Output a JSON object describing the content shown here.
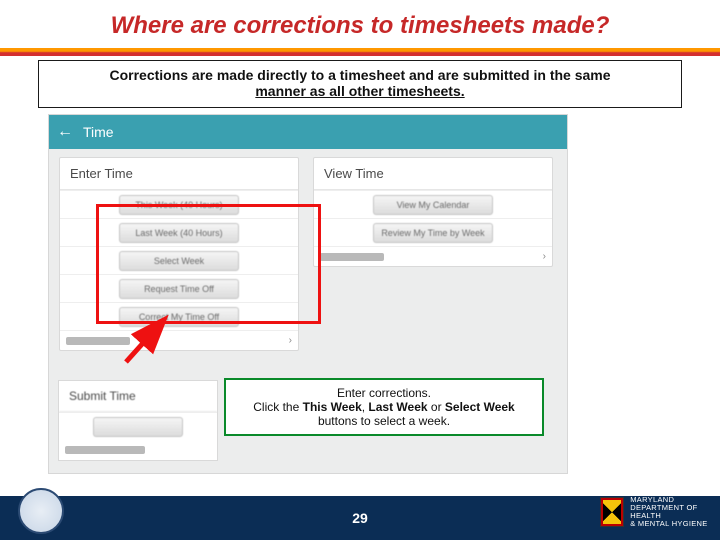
{
  "title": "Where are corrections to timesheets made?",
  "subtitle": {
    "line1": "Corrections are made directly to a timesheet and are submitted in the same",
    "line2": "manner as all other timesheets."
  },
  "wd": {
    "header_title": "Time",
    "back_glyph": "←",
    "left": {
      "heading": "Enter Time",
      "buttons": [
        "This Week (40 Hours)",
        "Last Week (40 Hours)",
        "Select Week",
        "Request Time Off",
        "Correct My Time Off"
      ]
    },
    "right": {
      "heading": "View Time",
      "buttons": [
        "View My Calendar",
        "Review My Time by Week"
      ]
    },
    "submit_heading": "Submit Time",
    "chevron": "›"
  },
  "callout": {
    "line1": "Enter corrections.",
    "line2a": "Click the ",
    "b1": "This Week",
    "sep1": ", ",
    "b2": "Last Week",
    "sep2": " or ",
    "b3": "Select Week",
    "line3": "buttons to select a week."
  },
  "page_number": "29",
  "logo": {
    "l1": "MARYLAND",
    "l2": "DEPARTMENT OF HEALTH",
    "l3": "& MENTAL HYGIENE"
  }
}
